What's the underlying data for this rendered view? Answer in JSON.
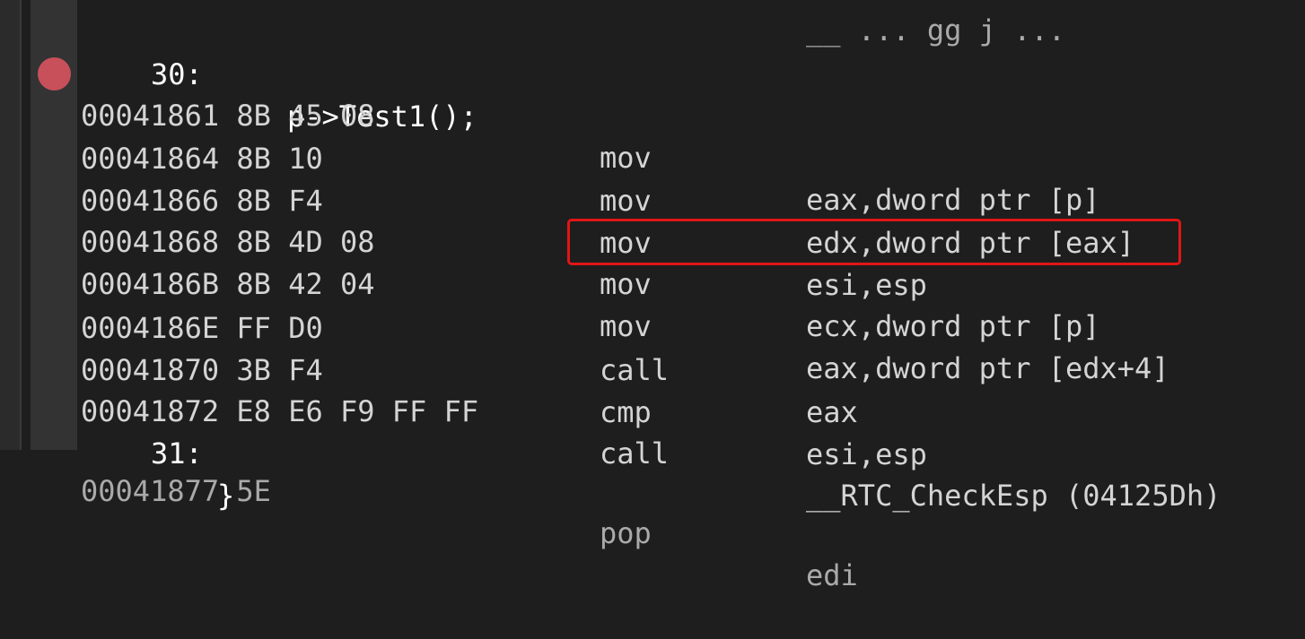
{
  "editor": {
    "source_lines": [
      {
        "number": "30:",
        "code": "p->Test1();"
      },
      {
        "number": "31:",
        "code": "}"
      }
    ],
    "instructions": [
      {
        "address": "00041861",
        "bytes": "8B 45 08",
        "mnemonic": "mov",
        "operands": "eax,dword ptr [p]"
      },
      {
        "address": "00041864",
        "bytes": "8B 10",
        "mnemonic": "mov",
        "operands": "edx,dword ptr [eax]"
      },
      {
        "address": "00041866",
        "bytes": "8B F4",
        "mnemonic": "mov",
        "operands": "esi,esp"
      },
      {
        "address": "00041868",
        "bytes": "8B 4D 08",
        "mnemonic": "mov",
        "operands": "ecx,dword ptr [p]"
      },
      {
        "address": "0004186B",
        "bytes": "8B 42 04",
        "mnemonic": "mov",
        "operands": "eax,dword ptr [edx+4]"
      },
      {
        "address": "0004186E",
        "bytes": "FF D0",
        "mnemonic": "call",
        "operands": "eax"
      },
      {
        "address": "00041870",
        "bytes": "3B F4",
        "mnemonic": "cmp",
        "operands": "esi,esp"
      },
      {
        "address": "00041872",
        "bytes": "E8 E6 F9 FF FF",
        "mnemonic": "call",
        "operands": "__RTC_CheckEsp (04125Dh)"
      }
    ],
    "clipped_top_text": "__ ... gg j ...",
    "clipped_bottom_address": "00041877 5E",
    "clipped_bottom_mnemonic": "pop",
    "clipped_bottom_operands": "edi",
    "breakpoint_row": "00041861",
    "highlighted_row": "0004186B",
    "colors": {
      "background": "#1e1e1e",
      "gutter": "#333333",
      "text": "#d4d4d4",
      "source_text": "#ffffff",
      "breakpoint": "#c8505a",
      "highlight_border": "#e01616"
    }
  }
}
